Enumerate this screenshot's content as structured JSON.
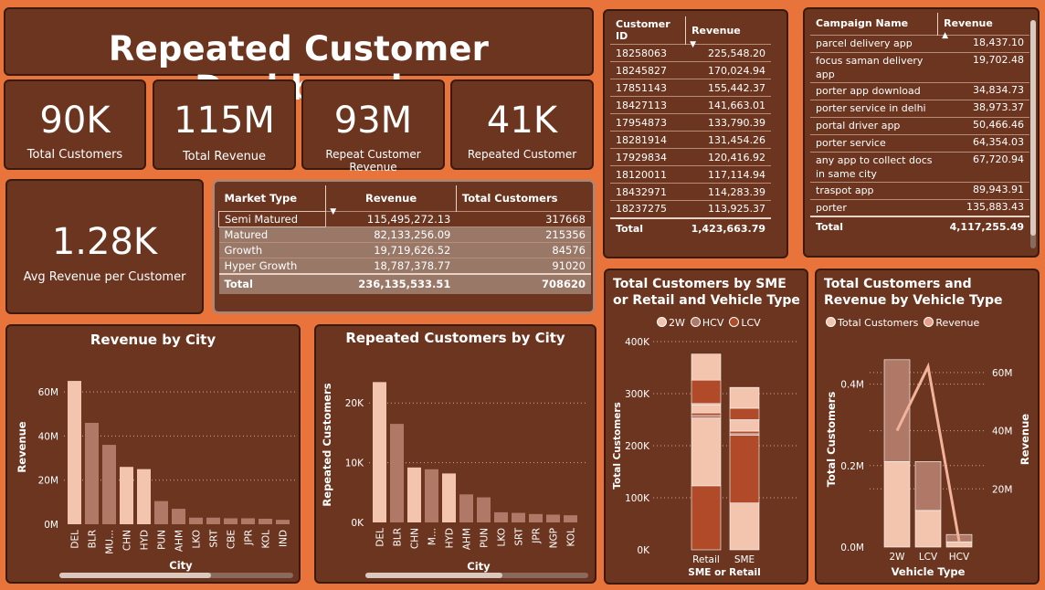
{
  "header": {
    "title": "Repeated Customer Dashboard"
  },
  "kpis": [
    {
      "value": "90K",
      "label": "Total Customers"
    },
    {
      "value": "115M",
      "label": "Total Revenue"
    },
    {
      "value": "93M",
      "label": "Repeat Customer Revenue"
    },
    {
      "value": "41K",
      "label": "Repeated Customer"
    }
  ],
  "avg_kpi": {
    "value": "1.28K",
    "label": "Avg Revenue per Customer"
  },
  "market_table": {
    "headers": [
      "Market Type",
      "Revenue",
      "Total Customers"
    ],
    "rows": [
      [
        "Semi Matured",
        "115,495,272.13",
        "317668"
      ],
      [
        "Matured",
        "82,133,256.09",
        "215356"
      ],
      [
        "Growth",
        "19,719,626.52",
        "84576"
      ],
      [
        "Hyper Growth",
        "18,787,378.77",
        "91020"
      ]
    ],
    "total": [
      "Total",
      "236,135,533.51",
      "708620"
    ]
  },
  "customer_table": {
    "headers": [
      "Customer ID",
      "Revenue"
    ],
    "rows": [
      [
        "18258063",
        "225,548.20"
      ],
      [
        "18245827",
        "170,024.94"
      ],
      [
        "17851143",
        "155,442.37"
      ],
      [
        "18427113",
        "141,663.01"
      ],
      [
        "17954873",
        "133,790.39"
      ],
      [
        "18281914",
        "131,454.26"
      ],
      [
        "17929834",
        "120,416.92"
      ],
      [
        "18120011",
        "117,114.94"
      ],
      [
        "18432971",
        "114,283.39"
      ],
      [
        "18237275",
        "113,925.37"
      ]
    ],
    "total": [
      "Total",
      "1,423,663.79"
    ]
  },
  "campaign_table": {
    "headers": [
      "Campaign Name",
      "Revenue"
    ],
    "rows": [
      [
        "parcel delivery app",
        "18,437.10"
      ],
      [
        "focus saman delivery app",
        "19,702.48"
      ],
      [
        "porter app download",
        "34,834.73"
      ],
      [
        "porter service in delhi",
        "38,973.37"
      ],
      [
        "portal driver app",
        "50,466.46"
      ],
      [
        "porter service",
        "64,354.03"
      ],
      [
        "any app to collect docs in same city",
        "67,720.94"
      ],
      [
        "traspot app",
        "89,943.91"
      ],
      [
        "porter",
        "135,883.43"
      ]
    ],
    "total": [
      "Total",
      "4,117,255.49"
    ]
  },
  "colors": {
    "background": "#E8743B",
    "card": "#6B3520",
    "bar_light": "#F3C4AE",
    "bar_mid": "#B07866",
    "bar_dark": "#B04A28"
  },
  "chart_data": [
    {
      "type": "bar",
      "title": "Revenue by City",
      "xlabel": "City",
      "ylabel": "Revenue",
      "categories": [
        "DEL",
        "BLR",
        "MU...",
        "CHN",
        "HYD",
        "PUN",
        "AHM",
        "LKO",
        "SRT",
        "CBE",
        "JPR",
        "KOL",
        "IND"
      ],
      "values": [
        65,
        46,
        36,
        26,
        25,
        10.5,
        7,
        3,
        3,
        2.7,
        2.7,
        2.5,
        2
      ],
      "unit": "M",
      "ylim": [
        0,
        70
      ],
      "yticks": [
        "0M",
        "20M",
        "40M",
        "60M"
      ],
      "ytick_vals": [
        0,
        20,
        40,
        60
      ]
    },
    {
      "type": "bar",
      "title": "Repeated Customers by City",
      "xlabel": "City",
      "ylabel": "Repeated Customers",
      "categories": [
        "DEL",
        "BLR",
        "CHN",
        "M...",
        "HYD",
        "AHM",
        "PUN",
        "LKO",
        "SRT",
        "JPR",
        "NGP",
        "KOL"
      ],
      "values": [
        23.5,
        16.5,
        9.2,
        8.9,
        8.2,
        4.7,
        4.2,
        1.7,
        1.6,
        1.4,
        1.3,
        1.2
      ],
      "unit": "K",
      "ylim": [
        0,
        26
      ],
      "yticks": [
        "0K",
        "10K",
        "20K"
      ],
      "ytick_vals": [
        0,
        10,
        20
      ]
    },
    {
      "type": "bar",
      "title": "Total Customers by SME or Retail and Vehicle Type",
      "xlabel": "SME or Retail",
      "ylabel": "Total Customers",
      "legend": [
        "2W",
        "HCV",
        "LCV"
      ],
      "categories": [
        "Retail",
        "SME"
      ],
      "stacks": [
        [
          {
            "series": "LCV",
            "value": 123
          },
          {
            "series": "2W",
            "value": 130
          },
          {
            "series": "HCV",
            "value": 5
          },
          {
            "series": "LCV",
            "value": 5
          },
          {
            "series": "2W",
            "value": 16
          },
          {
            "series": "HCV",
            "value": 2
          },
          {
            "series": "LCV",
            "value": 45
          },
          {
            "series": "2W",
            "value": 50
          }
        ],
        [
          {
            "series": "2W",
            "value": 90
          },
          {
            "series": "LCV",
            "value": 130
          },
          {
            "series": "HCV",
            "value": 3
          },
          {
            "series": "LCV",
            "value": 5
          },
          {
            "series": "2W",
            "value": 20
          },
          {
            "series": "HCV",
            "value": 2
          },
          {
            "series": "LCV",
            "value": 22
          },
          {
            "series": "2W",
            "value": 40
          }
        ]
      ],
      "ylim": [
        0,
        400
      ],
      "yticks": [
        "0K",
        "100K",
        "200K",
        "300K",
        "400K"
      ],
      "ytick_vals": [
        0,
        100,
        200,
        300,
        400
      ]
    },
    {
      "type": "bar",
      "title": "Total Customers and Revenue by Vehicle Type",
      "xlabel": "Vehicle Type",
      "ylabel": "Total Customers",
      "y2label": "Revenue",
      "legend": [
        "Total Customers",
        "Revenue"
      ],
      "categories": [
        "2W",
        "LCV",
        "HCV"
      ],
      "customers_lower": [
        0.21,
        0.09,
        0.013
      ],
      "customers_upper": [
        0.25,
        0.12,
        0.018
      ],
      "revenue": [
        40,
        62,
        2
      ],
      "ylim": [
        0,
        0.5
      ],
      "yticks": [
        "0.0M",
        "0.2M",
        "0.4M"
      ],
      "ytick_vals": [
        0,
        0.2,
        0.4
      ],
      "y2lim": [
        0,
        70
      ],
      "y2ticks": [
        "20M",
        "40M",
        "60M"
      ],
      "y2tick_vals": [
        20,
        40,
        60
      ]
    }
  ]
}
